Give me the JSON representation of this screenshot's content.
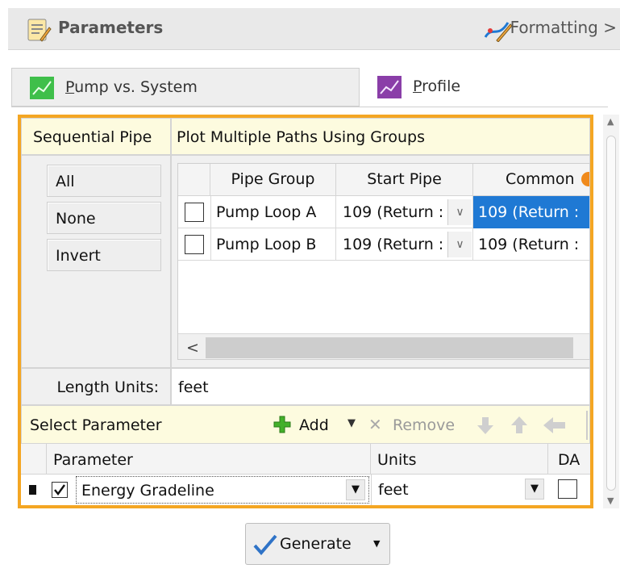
{
  "header": {
    "title": "Parameters",
    "formatting": "Formatting >"
  },
  "tabs": [
    {
      "label": "Pump vs. System",
      "mnemonic_prefix": "",
      "mnemonic": "P",
      "rest": "ump vs. System"
    },
    {
      "label": "Profile",
      "mnemonic": "P",
      "rest": "rofile"
    }
  ],
  "paths": {
    "left_header": "Sequential Pipe",
    "right_header": "Plot Multiple Paths Using Groups",
    "buttons": [
      "All",
      "None",
      "Invert"
    ],
    "columns": [
      "Pipe Group",
      "Start Pipe",
      "Common"
    ],
    "rows": [
      {
        "checked": false,
        "group": "Pump Loop A",
        "start": "109 (Return :",
        "common": "109 (Return :",
        "common_selected": true
      },
      {
        "checked": false,
        "group": "Pump Loop B",
        "start": "109 (Return :",
        "common": "109 (Return :",
        "common_selected": false
      }
    ],
    "hscroll_left": "<"
  },
  "length_units": {
    "label": "Length Units:",
    "value": "feet"
  },
  "parameters": {
    "header": "Select Parameter",
    "toolbar": {
      "add": "Add",
      "remove": "Remove"
    },
    "columns": [
      "Parameter",
      "Units",
      "DA"
    ],
    "rows": [
      {
        "checked": true,
        "parameter": "Energy Gradeline",
        "units": "feet",
        "da": false
      }
    ]
  },
  "generate": {
    "label": "Generate"
  },
  "colors": {
    "accent_frame": "#f4a623",
    "selection": "#1f79d4",
    "add_green": "#43b02a"
  }
}
